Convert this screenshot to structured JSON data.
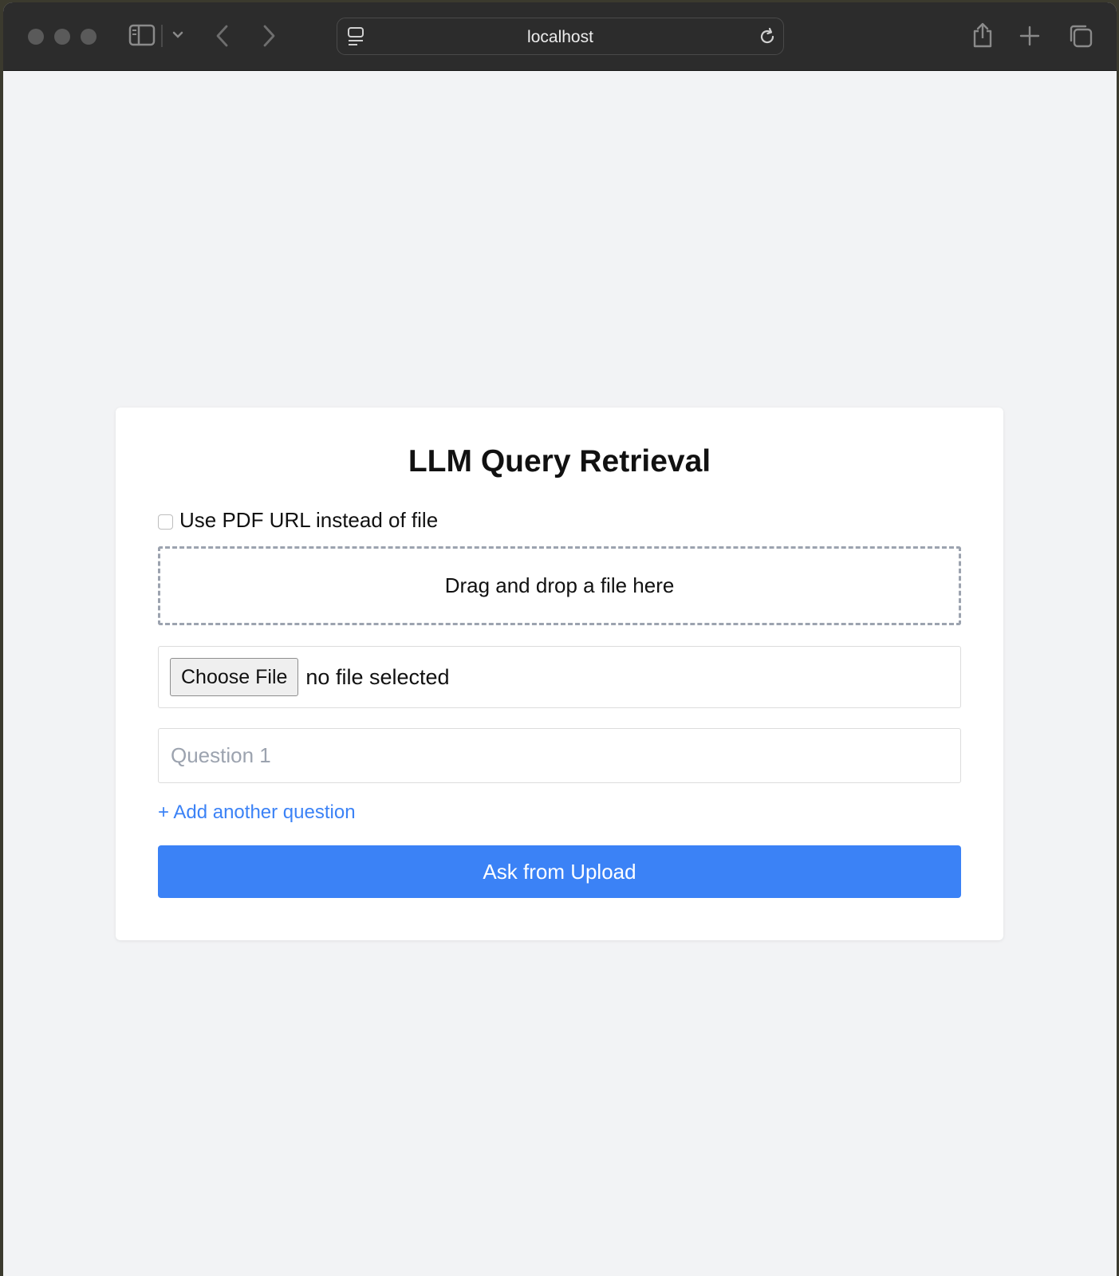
{
  "browser": {
    "url": "localhost",
    "icons": {
      "sidebar": "sidebar-icon",
      "chevron": "chevron-down-icon",
      "back": "back-arrow-icon",
      "forward": "forward-arrow-icon",
      "page_menu": "page-menu-icon",
      "reload": "reload-icon",
      "share": "share-icon",
      "new_tab": "plus-icon",
      "tabs": "tab-overview-icon"
    }
  },
  "form": {
    "title": "LLM Query Retrieval",
    "use_url_label": "Use PDF URL instead of file",
    "use_url_checked": false,
    "dropzone_text": "Drag and drop a file here",
    "choose_file_label": "Choose File",
    "file_status": "no file selected",
    "question_placeholder": "Question 1",
    "question_value": "",
    "add_question_label": "+ Add another question",
    "submit_label": "Ask from Upload"
  },
  "colors": {
    "accent": "#3b82f6",
    "page_bg": "#f2f3f5",
    "toolbar_bg": "#2c2c2c"
  }
}
